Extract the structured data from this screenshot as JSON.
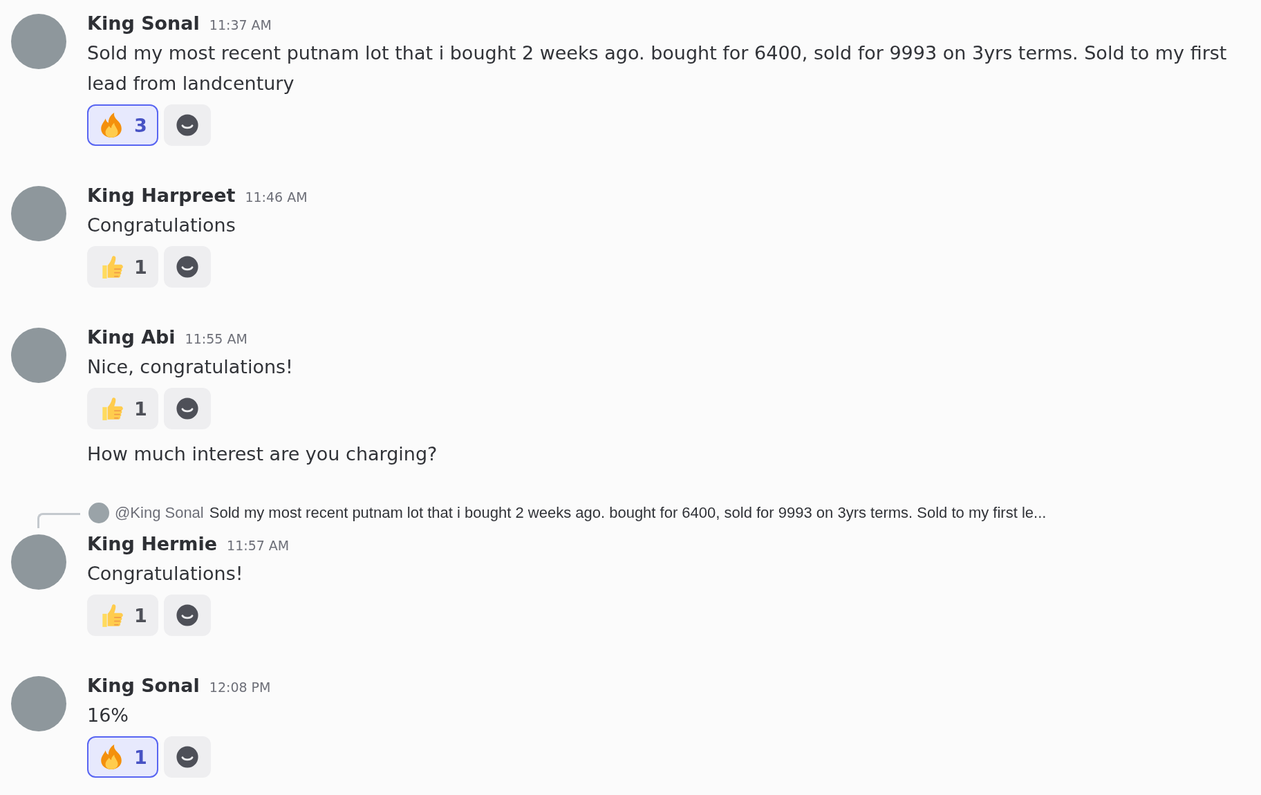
{
  "messages": [
    {
      "author": "King Sonal",
      "time": "11:37 AM",
      "blocks": [
        {
          "text": "Sold my most recent putnam lot that i bought 2 weeks ago. bought for 6400, sold for 9993 on 3yrs terms. Sold to my first lead from landcentury",
          "reactions": [
            {
              "kind": "fire",
              "count": "3",
              "selected": true
            }
          ]
        }
      ]
    },
    {
      "author": "King Harpreet",
      "time": "11:46 AM",
      "blocks": [
        {
          "text": "Congratulations",
          "reactions": [
            {
              "kind": "thumbs-up",
              "count": "1",
              "selected": false
            }
          ]
        }
      ]
    },
    {
      "author": "King Abi",
      "time": "11:55 AM",
      "blocks": [
        {
          "text": "Nice, congratulations!",
          "reactions": [
            {
              "kind": "thumbs-up",
              "count": "1",
              "selected": false
            }
          ]
        },
        {
          "text": "How much interest are you charging?"
        }
      ]
    },
    {
      "author": "King Hermie",
      "time": "11:57 AM",
      "reply": {
        "mention": "@King Sonal",
        "text": "Sold my most recent putnam lot that i bought 2 weeks ago. bought for 6400, sold for 9993 on 3yrs terms. Sold to my first le..."
      },
      "blocks": [
        {
          "text": "Congratulations!",
          "reactions": [
            {
              "kind": "thumbs-up",
              "count": "1",
              "selected": false
            }
          ]
        }
      ]
    },
    {
      "author": "King Sonal",
      "time": "12:08 PM",
      "blocks": [
        {
          "text": "16%",
          "reactions": [
            {
              "kind": "fire",
              "count": "1",
              "selected": true
            }
          ]
        }
      ]
    }
  ]
}
